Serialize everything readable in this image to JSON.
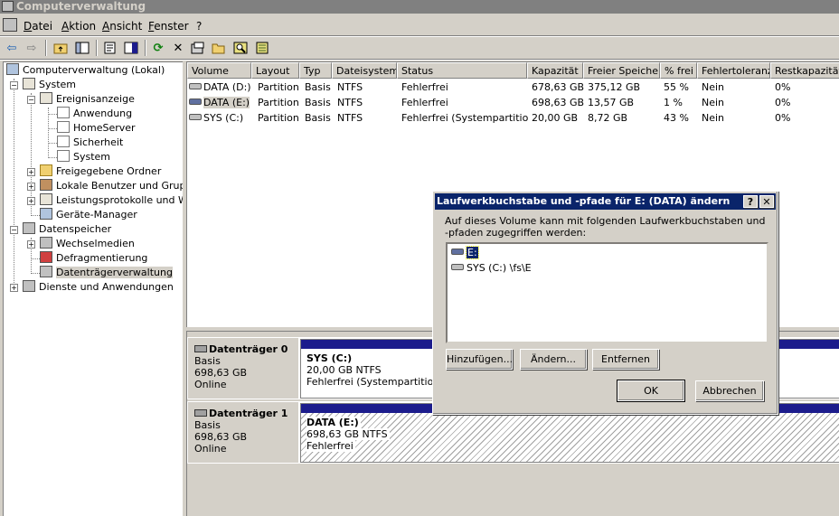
{
  "window": {
    "title": "Computerverwaltung"
  },
  "menu": [
    "Datei",
    "Aktion",
    "Ansicht",
    "Fenster",
    "?"
  ],
  "toolbar": {
    "icons": [
      "back-arrow-icon",
      "forward-arrow-icon",
      "up-folder-icon",
      "show-hide-tree-icon",
      "properties-icon",
      "help-icon",
      "refresh-icon",
      "delete-icon",
      "properties-icon-2",
      "open-icon",
      "search-icon",
      "settings-icon"
    ]
  },
  "tree": {
    "root": "Computerverwaltung (Lokal)",
    "system": "System",
    "ereignisanzeige": "Ereignisanzeige",
    "anwendung": "Anwendung",
    "homeserver": "HomeServer",
    "sicherheit": "Sicherheit",
    "system_log": "System",
    "freigegebene_ordner": "Freigegebene Ordner",
    "lokale_benutzer": "Lokale Benutzer und Gruppe",
    "leistungsprotokolle": "Leistungsprotokolle und War",
    "geraete_manager": "Geräte-Manager",
    "datenspeicher": "Datenspeicher",
    "wechselmedien": "Wechselmedien",
    "defragmentierung": "Defragmentierung",
    "datentraegerverwaltung": "Datenträgerverwaltung",
    "dienste": "Dienste und Anwendungen"
  },
  "volumes": {
    "columns": [
      "Volume",
      "Layout",
      "Typ",
      "Dateisystem",
      "Status",
      "Kapazität",
      "Freier Speicher",
      "% frei",
      "Fehlertoleranz",
      "Restkapazität"
    ],
    "rows": [
      {
        "volume": "DATA (D:)",
        "layout": "Partition",
        "typ": "Basis",
        "fs": "NTFS",
        "status": "Fehlerfrei",
        "kapazitaet": "678,63 GB",
        "frei": "375,12 GB",
        "pfrei": "55 %",
        "fehlertoleranz": "Nein",
        "rest": "0%"
      },
      {
        "volume": "DATA (E:)",
        "layout": "Partition",
        "typ": "Basis",
        "fs": "NTFS",
        "status": "Fehlerfrei",
        "kapazitaet": "698,63 GB",
        "frei": "13,57 GB",
        "pfrei": "1 %",
        "fehlertoleranz": "Nein",
        "rest": "0%"
      },
      {
        "volume": "SYS (C:)",
        "layout": "Partition",
        "typ": "Basis",
        "fs": "NTFS",
        "status": "Fehlerfrei (Systempartition)",
        "kapazitaet": "20,00 GB",
        "frei": "8,72 GB",
        "pfrei": "43 %",
        "fehlertoleranz": "Nein",
        "rest": "0%"
      }
    ]
  },
  "disks": [
    {
      "name": "Datenträger 0",
      "type": "Basis",
      "size": "698,63 GB",
      "state": "Online",
      "partition": {
        "title": "SYS  (C:)",
        "size": "20,00 GB NTFS",
        "status": "Fehlerfrei (Systempartition)"
      }
    },
    {
      "name": "Datenträger 1",
      "type": "Basis",
      "size": "698,63 GB",
      "state": "Online",
      "partition": {
        "title": "DATA  (E:)",
        "size": "698,63 GB NTFS",
        "status": "Fehlerfrei"
      }
    }
  ],
  "dialog": {
    "title": "Laufwerkbuchstabe und -pfade für E: (DATA) ändern",
    "description": "Auf dieses Volume kann mit folgenden Laufwerkbuchstaben und -pfaden zugegriffen werden:",
    "items": [
      "E:",
      "SYS (C:) \\fs\\E"
    ],
    "buttons": {
      "add": "Hinzufügen...",
      "change": "Ändern...",
      "remove": "Entfernen",
      "ok": "OK",
      "cancel": "Abbrechen"
    },
    "help": "?",
    "close": "✕"
  },
  "colors": {
    "selection": "#0a246a",
    "partition_bar": "#1c1c8c",
    "face": "#d4d0c8"
  }
}
